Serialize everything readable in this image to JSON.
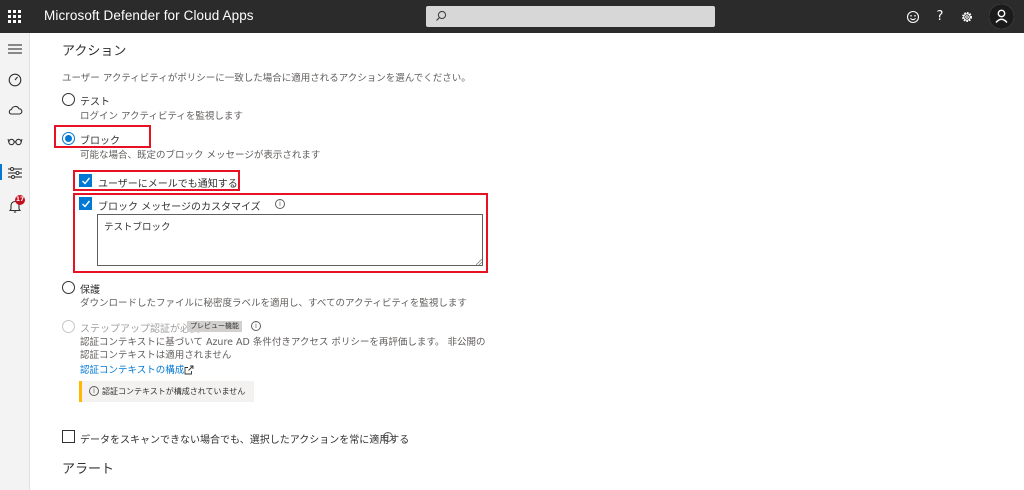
{
  "header": {
    "app_title": "Microsoft Defender for Cloud Apps",
    "search_placeholder": "",
    "icons": [
      "waffle-icon",
      "search-icon",
      "smiley-icon",
      "help-icon",
      "settings-icon",
      "avatar-icon"
    ],
    "help_glyph": "?",
    "bg_color": "#2b2b2b"
  },
  "leftnav": {
    "items": [
      "hamburger-icon",
      "dashboard-icon",
      "cloud-icon",
      "glasses-icon",
      "policies-icon",
      "alerts-icon"
    ],
    "alert_count": "17",
    "active_item": "policies-icon"
  },
  "actions": {
    "heading": "アクション",
    "description": "ユーザー アクティビティがポリシーに一致した場合に適用されるアクションを選んでください。",
    "options": [
      {
        "label": "テスト",
        "sub": "ログイン アクティビティを監視します",
        "checked": false
      },
      {
        "label": "ブロック",
        "sub": "可能な場合、既定のブロック メッセージが表示されます",
        "checked": true
      },
      {
        "label": "保護",
        "sub": "ダウンロードしたファイルに秘密度ラベルを適用し、すべてのアクティビティを監視します",
        "checked": false
      },
      {
        "label": "ステップアップ認証が必要",
        "badge": "プレビュー機能",
        "sub_line1": "認証コンテキストに基づいて Azure AD 条件付きアクセス ポリシーを再評価します。 非公開の",
        "sub_line2": "認証コンテキストは適用されません",
        "checked": false,
        "disabled": true
      }
    ],
    "notify_user_label": "ユーザーにメールでも通知する",
    "notify_user_checked": true,
    "custom_message_label": "ブロック メッセージのカスタマイズ",
    "custom_message_checked": true,
    "custom_message_value": "テストブロック",
    "auth_context_link": "認証コンテキストの構成",
    "auth_context_notice": "認証コンテキストが構成されていません",
    "always_apply_label": "データをスキャンできない場合でも、選択したアクションを常に適用する",
    "always_apply_checked": false
  },
  "alerts": {
    "heading": "アラート"
  },
  "colors": {
    "accent": "#0078d4",
    "highlight_box": "#e81123",
    "notice_bar": "#ffb900"
  }
}
